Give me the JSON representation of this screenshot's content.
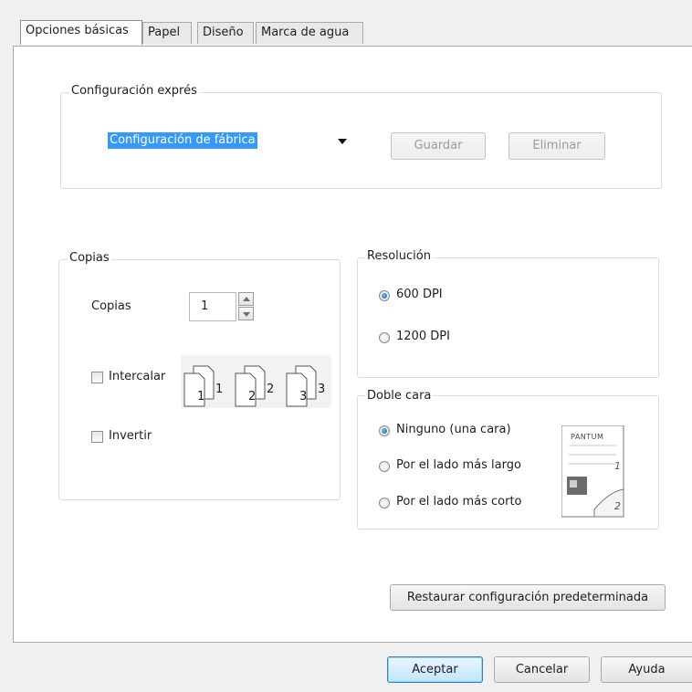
{
  "tabs": {
    "items": [
      {
        "label": "Opciones básicas"
      },
      {
        "label": "Papel"
      },
      {
        "label": "Diseño"
      },
      {
        "label": "Marca de agua"
      }
    ]
  },
  "express": {
    "legend": "Configuración exprés",
    "selected": "Configuración de fábrica",
    "save_label": "Guardar",
    "delete_label": "Eliminar"
  },
  "copies": {
    "legend": "Copias",
    "count_label": "Copias",
    "count_value": "1",
    "collate_label": "Intercalar",
    "reverse_label": "Invertir",
    "collate_pages": [
      "1",
      "1",
      "2",
      "2",
      "3",
      "3"
    ]
  },
  "resolution": {
    "legend": "Resolución",
    "options": [
      {
        "label": "600 DPI",
        "selected": true
      },
      {
        "label": "1200 DPI",
        "selected": false
      }
    ]
  },
  "duplex": {
    "legend": "Doble cara",
    "options": [
      {
        "label": "Ninguno (una cara)",
        "selected": true
      },
      {
        "label": "Por el lado más largo",
        "selected": false
      },
      {
        "label": "Por el lado más corto",
        "selected": false
      }
    ],
    "preview_brand": "PANTUM",
    "preview_pages": [
      "1",
      "2"
    ]
  },
  "restore_label": "Restaurar configuración predeterminada",
  "footer": {
    "ok_label": "Aceptar",
    "cancel_label": "Cancelar",
    "help_label": "Ayuda"
  },
  "colors": {
    "selection_bg": "#3399ff",
    "accent": "#3c7fb1"
  }
}
